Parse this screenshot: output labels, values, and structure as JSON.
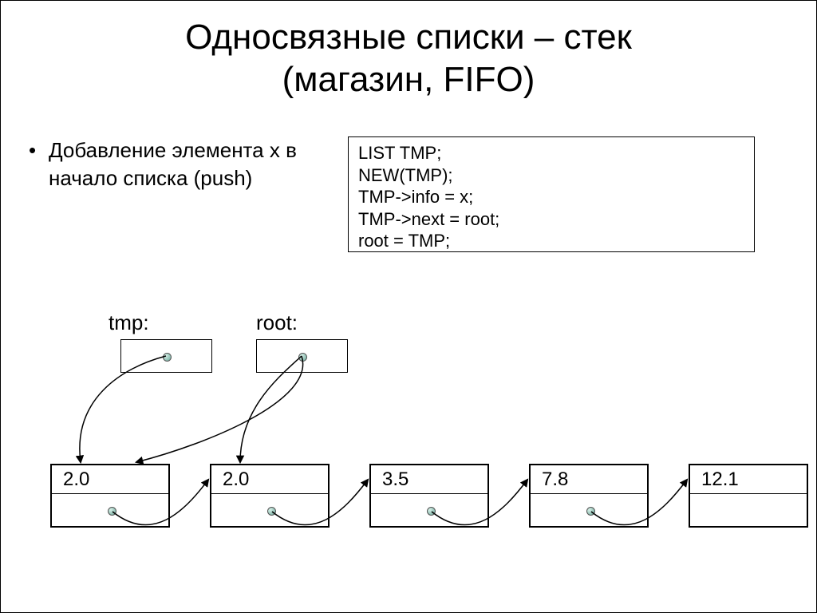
{
  "title_line1": "Односвязные списки – стек",
  "title_line2": "(магазин, FIFO)",
  "bullet_text": "Добавление элемента x в начало списка (push)",
  "code": "LIST TMP;\nNEW(TMP);\nTMP->info = x;\nTMP->next = root;\nroot = TMP;",
  "labels": {
    "tmp": "tmp:",
    "root": "root:"
  },
  "nodes": [
    {
      "value": "2.0"
    },
    {
      "value": "2.0"
    },
    {
      "value": "3.5"
    },
    {
      "value": "7.8"
    },
    {
      "value": "12.1"
    }
  ]
}
